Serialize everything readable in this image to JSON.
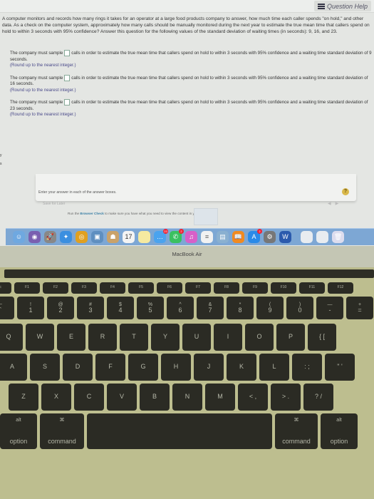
{
  "header": {
    "question_help": "Question Help"
  },
  "question": {
    "intro": "A computer monitors and records how many rings it takes for an operator at a large food products company to answer, how much time each caller spends \"on hold,\" and other data. As a check on the computer system, approximately how many calls should be manually monitored during the next year to estimate the true mean time that callers spend on hold to within 3 seconds with 95% confidence? Answer this question for the following values of the standard deviation of waiting times (in seconds): 9, 16, and 23."
  },
  "parts": [
    {
      "prefix": "The company must sample",
      "suffix": "calls in order to estimate the true mean time that callers spend on hold to within 3 seconds with 95% confidence and a waiting time standard deviation of 9 seconds.",
      "hint": "(Round up to the nearest integer.)",
      "value": ""
    },
    {
      "prefix": "The company must sample",
      "suffix": "calls in order to estimate the true mean time that callers spend on hold to within 3 seconds with 95% confidence and a waiting time standard deviation of  16 seconds.",
      "hint": "(Round up to the nearest integer.)",
      "value": ""
    },
    {
      "prefix": "The company must sample",
      "suffix": "calls in order to estimate the true mean time that callers spend on hold to within 3 seconds with 95% confidence and a waiting time standard deviation of 23 seconds.",
      "hint": "(Round up to the nearest integer.)",
      "value": ""
    }
  ],
  "footer": {
    "instruction": "Enter your answer in each of the answer boxes.",
    "save_later": "Save for Later",
    "help_icon": "?",
    "prev": "◀",
    "next": "▶"
  },
  "background_page": {
    "browser_check_pre": "Run the ",
    "browser_check_link": "Browser Check",
    "browser_check_post": " to make sure you have what you need to view the content in your course."
  },
  "dock": {
    "items": [
      {
        "name": "finder",
        "glyph": "☺",
        "color": "#6fa8e0"
      },
      {
        "name": "siri",
        "glyph": "◉",
        "color": "#7a5fb0"
      },
      {
        "name": "launchpad",
        "glyph": "🚀",
        "color": "#888"
      },
      {
        "name": "safari",
        "glyph": "✦",
        "color": "#3b8fe0"
      },
      {
        "name": "chrome",
        "glyph": "◎",
        "color": "#e0a020"
      },
      {
        "name": "preview",
        "glyph": "▣",
        "color": "#5f8fc0"
      },
      {
        "name": "contacts",
        "glyph": "☗",
        "color": "#c9a26a"
      },
      {
        "name": "calendar",
        "glyph": "17",
        "color": "#f4f4f4",
        "text": "#333",
        "label": "17"
      },
      {
        "name": "notes",
        "glyph": "",
        "color": "#f5eaa0"
      },
      {
        "name": "messages",
        "glyph": "…",
        "color": "#4aa3ee",
        "badge": "23"
      },
      {
        "name": "facetime",
        "glyph": "✆",
        "color": "#3ac060",
        "badge": "2"
      },
      {
        "name": "itunes",
        "glyph": "♫",
        "color": "#d860c8"
      },
      {
        "name": "reminders",
        "glyph": "≡",
        "color": "#f2f2f2",
        "text": "#666"
      },
      {
        "name": "photo-booth",
        "glyph": "▤",
        "color": "#8ab0d0"
      },
      {
        "name": "ibooks",
        "glyph": "📖",
        "color": "#f08a20"
      },
      {
        "name": "app-store",
        "glyph": "A",
        "color": "#2a8ae8",
        "badge": "2"
      },
      {
        "name": "system-preferences",
        "glyph": "⚙",
        "color": "#777"
      },
      {
        "name": "word",
        "glyph": "W",
        "color": "#2b5aad"
      },
      {
        "name": "document-1",
        "glyph": "",
        "color": "#e8ecf0"
      },
      {
        "name": "document-2",
        "glyph": "",
        "color": "#e8ecf0"
      },
      {
        "name": "trash",
        "glyph": "🗑",
        "color": "#dde"
      }
    ]
  },
  "laptop": {
    "label": "MacBook Air"
  },
  "keyboard": {
    "fn": [
      "esc",
      "F1",
      "F2",
      "F3",
      "F4",
      "F5",
      "F6",
      "F7",
      "F8",
      "F9",
      "F10",
      "F11",
      "F12"
    ],
    "numbers": [
      [
        "~",
        "`"
      ],
      [
        "!",
        "1"
      ],
      [
        "@",
        "2"
      ],
      [
        "#",
        "3"
      ],
      [
        "$",
        "4"
      ],
      [
        "%",
        "5"
      ],
      [
        "^",
        "6"
      ],
      [
        "&",
        "7"
      ],
      [
        "*",
        "8"
      ],
      [
        "(",
        "9"
      ],
      [
        ")",
        "0"
      ],
      [
        "—",
        "-"
      ],
      [
        "+",
        "="
      ]
    ],
    "qwerty": [
      "Q",
      "W",
      "E",
      "R",
      "T",
      "Y",
      "U",
      "I",
      "O",
      "P",
      "{ ["
    ],
    "asdf": [
      "A",
      "S",
      "D",
      "F",
      "G",
      "H",
      "J",
      "K",
      "L",
      ": ;",
      "\" '"
    ],
    "zxcv": [
      "Z",
      "X",
      "C",
      "V",
      "B",
      "N",
      "M",
      "< ,",
      "> .",
      "? /"
    ],
    "bottom": {
      "left_alt": "alt",
      "left_option": "option",
      "left_cmd_symbol": "⌘",
      "left_command": "command",
      "right_cmd_symbol": "⌘",
      "right_command": "command",
      "right_alt": "alt",
      "right_option": "option"
    }
  }
}
